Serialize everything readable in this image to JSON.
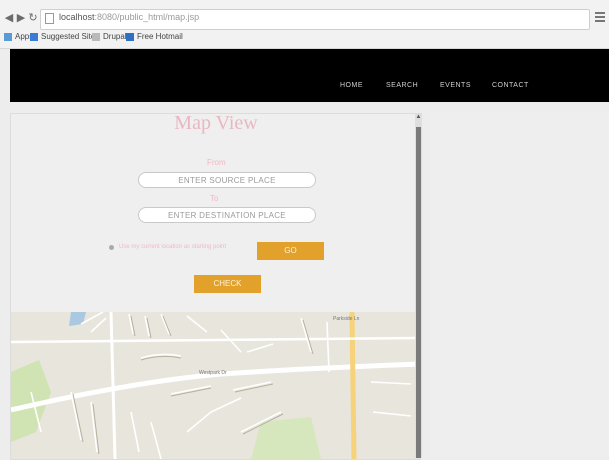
{
  "browser": {
    "url_host": "localhost",
    "url_path": ":8080/public_html/map.jsp",
    "bookmarks": [
      "Apps",
      "Suggested Sites",
      "Drupal",
      "Free Hotmail"
    ]
  },
  "nav": {
    "items": [
      "HOME",
      "SEARCH",
      "EVENTS",
      "CONTACT"
    ]
  },
  "page": {
    "title": "Map View",
    "source": {
      "label": "From",
      "placeholder": "ENTER SOURCE PLACE"
    },
    "destination": {
      "label": "To",
      "placeholder": "ENTER DESTINATION PLACE"
    },
    "option_text": "Use my current location as starting point",
    "option_button": "GO",
    "submit_button": "CHECK"
  },
  "map": {
    "road_label_1": "Parkside Ln",
    "road_label_2": "Westpark Dr"
  },
  "colors": {
    "accent": "#e1a12a",
    "title_pink": "#e7b8c2",
    "nav_bg": "#000000"
  }
}
